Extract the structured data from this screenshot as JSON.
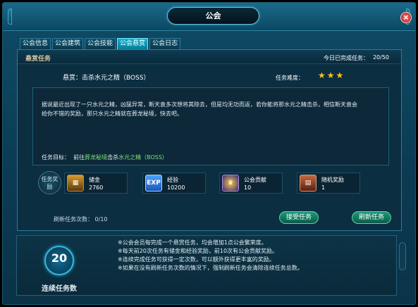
{
  "window": {
    "title": "公会",
    "close_label": "×"
  },
  "tabs": [
    {
      "label": "公会信息"
    },
    {
      "label": "公会建筑"
    },
    {
      "label": "公会技能"
    },
    {
      "label": "公会悬赏",
      "active": true
    },
    {
      "label": "公会日志"
    }
  ],
  "panel": {
    "title": "悬赏任务",
    "today_label": "今日已完成任务：",
    "today_value": "20/50",
    "reward_title": "悬赏：击杀水元之精（BOSS）",
    "difficulty_label": "任务难度：",
    "difficulty_stars": 3,
    "description": "据说最近出现了一只水元之精，凶猛异常，断天袁多次想将其除去，但是均无功而返，若你能将那水元之精击杀，相信断天袁会给你不错的奖励，那只水元之精就在葬龙秘境，快去吧。",
    "goal_label": "任务目标：",
    "goal_prefix": "前往",
    "goal_place": "葬龙秘境",
    "goal_mid": "击杀",
    "goal_target": "水元之精（BOSS）",
    "rewards_badge": "任务奖励",
    "rewards": [
      {
        "name": "储金",
        "value": "2760",
        "icon": "gold-chest-icon",
        "color": "#5a3a12"
      },
      {
        "name": "经验",
        "value": "10200",
        "icon": "exp-icon",
        "color": "#1d57b8",
        "glyph": "EXP"
      },
      {
        "name": "公会贡献",
        "value": "10",
        "icon": "contribution-icon",
        "color": "#3b2a7a"
      },
      {
        "name": "随机奖励",
        "value": "1",
        "icon": "random-reward-icon",
        "color": "#5b1e14"
      }
    ],
    "refresh_label": "刷新任务次数：",
    "refresh_value": "0/10",
    "accept_label": "接受任务",
    "refresh_btn_label": "刷新任务"
  },
  "bottom": {
    "streak_value": "20",
    "streak_label": "连续任务数",
    "notes": [
      "※公会会员每完成一个悬赏任务，均会增加1点公会繁荣度。",
      "※每天前20次任务有储金和经验奖励，前10次有公会贡献奖励。",
      "※连续完成任务可获得一定次数，可以额外获得更丰富的奖励。",
      "※如果在没有刷新任务次数的情况下，强制刷新任务会清除连续任务总数。"
    ]
  },
  "colors": {
    "accent": "#0fb3cf",
    "star": "#ffc21a",
    "goal": "#7ee07a",
    "button": "#1d9a7a"
  }
}
